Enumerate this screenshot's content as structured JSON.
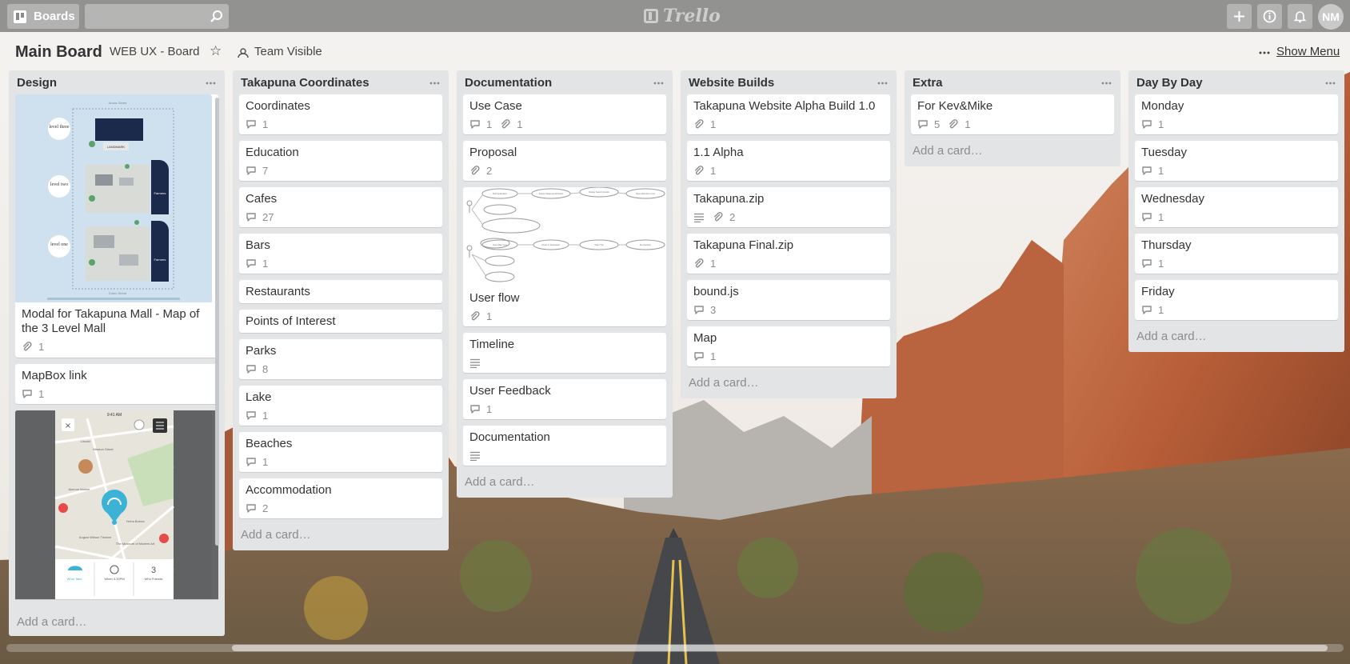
{
  "topbar": {
    "boards_label": "Boards",
    "search_placeholder": "",
    "logo_text": "Trello",
    "avatar_initials": "NM"
  },
  "board": {
    "title": "Main Board",
    "organization": "WEB UX - Board",
    "star": "☆",
    "visibility": "Team Visible",
    "show_menu": "Show Menu"
  },
  "lists": [
    {
      "title": "Design",
      "cards": [
        {
          "title": "Modal for Takapuna Mall - Map of the 3 Level Mall",
          "attachments": "1"
        },
        {
          "title": "MapBox link",
          "comments": "1"
        }
      ],
      "add_card": "Add a card…"
    },
    {
      "title": "Takapuna Coordinates",
      "cards": [
        {
          "title": "Coordinates",
          "comments": "1"
        },
        {
          "title": "Education",
          "comments": "7"
        },
        {
          "title": "Cafes",
          "comments": "27"
        },
        {
          "title": "Bars",
          "comments": "1"
        },
        {
          "title": "Restaurants"
        },
        {
          "title": "Points of Interest"
        },
        {
          "title": "Parks",
          "comments": "8"
        },
        {
          "title": "Lake",
          "comments": "1"
        },
        {
          "title": "Beaches",
          "comments": "1"
        },
        {
          "title": "Accommodation",
          "comments": "2"
        }
      ],
      "add_card": "Add a card…"
    },
    {
      "title": "Documentation",
      "cards": [
        {
          "title": "Use Case",
          "comments": "1",
          "attachments": "1"
        },
        {
          "title": "Proposal",
          "attachments": "2"
        },
        {
          "title": "User flow",
          "attachments": "1"
        },
        {
          "title": "Timeline"
        },
        {
          "title": "User Feedback",
          "comments": "1"
        },
        {
          "title": "Documentation"
        }
      ],
      "add_card": "Add a card…"
    },
    {
      "title": "Website Builds",
      "cards": [
        {
          "title": "Takapuna Website Alpha Build 1.0",
          "attachments": "1"
        },
        {
          "title": "1.1 Alpha",
          "attachments": "1"
        },
        {
          "title": "Takapuna.zip",
          "attachments": "2"
        },
        {
          "title": "Takapuna Final.zip",
          "attachments": "1"
        },
        {
          "title": "bound.js",
          "comments": "3"
        },
        {
          "title": "Map",
          "comments": "1"
        }
      ],
      "add_card": "Add a card…"
    },
    {
      "title": "Extra",
      "cards": [
        {
          "title": "For Kev&Mike",
          "comments": "5",
          "attachments": "1"
        }
      ],
      "add_card": "Add a card…"
    },
    {
      "title": "Day By Day",
      "cards": [
        {
          "title": "Monday",
          "comments": "1"
        },
        {
          "title": "Tuesday",
          "comments": "1"
        },
        {
          "title": "Wednesday",
          "comments": "1"
        },
        {
          "title": "Thursday",
          "comments": "1"
        },
        {
          "title": "Friday",
          "comments": "1"
        }
      ],
      "add_card": "Add a card…"
    }
  ],
  "images": {
    "mall_map": {
      "street_top": "Anzac Street",
      "street_bottom": "Como Street",
      "levels": [
        "level three",
        "level two",
        "level one"
      ],
      "store_label": "Farmers",
      "top_store": "LANDMARK"
    },
    "phone_map": {
      "time": "9:41 AM",
      "tab_labels": [
        "What Tabs",
        "When 3.30PM",
        "Who Friends"
      ],
      "count": "3",
      "streets": [
        "Lincoln",
        "Mission Street",
        "Avenue Market",
        "Yerba Buena",
        "August Wilson Theatre",
        "The Museum of Modern Art"
      ]
    },
    "flow_diagram": {
      "node_labels": [
        "Start Application",
        "Search Takapuna Attraction",
        "Display Search Results",
        "Save Attraction to List",
        "Open Map View",
        "Route to Destination",
        "Share Trip",
        "End Session"
      ]
    }
  },
  "colors": {
    "topbar": "#767676",
    "list_bg": "#e2e4e6",
    "card_bg": "#ffffff",
    "muted_text": "#8c8c8c",
    "map_bg": "#cfe1ee",
    "farmers_navy": "#1b2a4a",
    "map_pin": "#3cb3d6"
  },
  "icons": {
    "comment": "speech-bubble-icon",
    "attachment": "paperclip-icon",
    "description": "description-lines-icon",
    "boards": "board-icon",
    "search": "search-icon",
    "add": "plus-icon",
    "info": "info-icon",
    "notifications": "bell-icon"
  }
}
